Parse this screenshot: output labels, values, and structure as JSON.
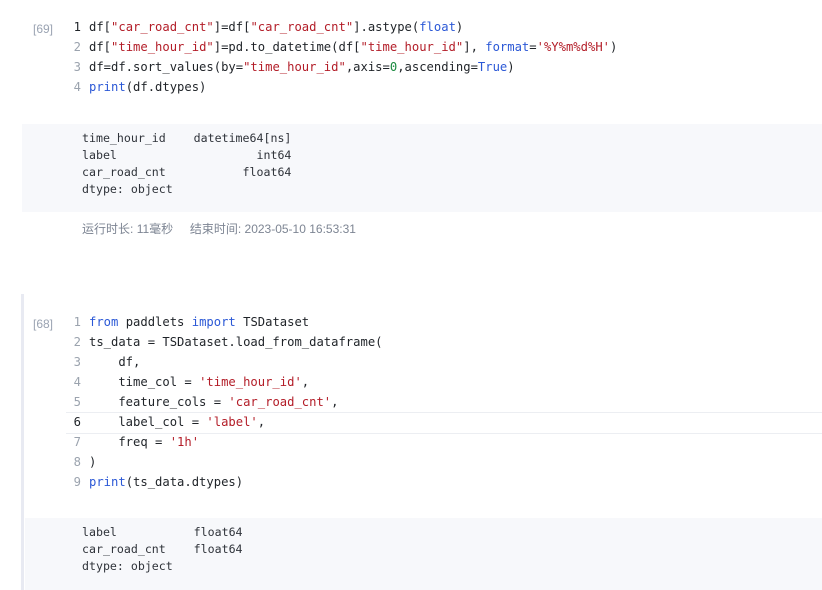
{
  "cells": [
    {
      "prompt": "[69]",
      "lines": [
        {
          "num": "1",
          "current": true,
          "tokens": [
            [
              "t",
              "df["
            ],
            [
              "s",
              "\"car_road_cnt\""
            ],
            [
              "t",
              "]=df["
            ],
            [
              "s",
              "\"car_road_cnt\""
            ],
            [
              "t",
              "].astype("
            ],
            [
              "k",
              "float"
            ],
            [
              "t",
              ")"
            ]
          ]
        },
        {
          "num": "2",
          "tokens": [
            [
              "t",
              "df["
            ],
            [
              "s",
              "\"time_hour_id\""
            ],
            [
              "t",
              "]=pd.to_datetime(df["
            ],
            [
              "s",
              "\"time_hour_id\""
            ],
            [
              "t",
              "], "
            ],
            [
              "k",
              "format"
            ],
            [
              "t",
              "="
            ],
            [
              "s",
              "'%Y%m%d%H'"
            ],
            [
              "t",
              ")"
            ]
          ]
        },
        {
          "num": "3",
          "tokens": [
            [
              "t",
              "df=df.sort_values(by="
            ],
            [
              "s",
              "\"time_hour_id\""
            ],
            [
              "t",
              ",axis="
            ],
            [
              "n",
              "0"
            ],
            [
              "t",
              ",ascending="
            ],
            [
              "k",
              "True"
            ],
            [
              "t",
              ")"
            ]
          ]
        },
        {
          "num": "4",
          "tokens": [
            [
              "k",
              "print"
            ],
            [
              "t",
              "(df.dtypes)"
            ]
          ]
        }
      ],
      "output": "time_hour_id    datetime64[ns]\nlabel                    int64\ncar_road_cnt           float64\ndtype: object",
      "exec_label": "运行时长:",
      "exec_duration": "11毫秒",
      "end_label": "结束时间:",
      "end_time": "2023-05-10 16:53:31"
    },
    {
      "prompt": "[68]",
      "lines": [
        {
          "num": "1",
          "tokens": [
            [
              "k",
              "from"
            ],
            [
              "t",
              " paddlets "
            ],
            [
              "k",
              "import"
            ],
            [
              "t",
              " TSDataset"
            ]
          ]
        },
        {
          "num": "2",
          "tokens": [
            [
              "t",
              "ts_data = TSDataset.load_from_dataframe("
            ]
          ]
        },
        {
          "num": "3",
          "tokens": [
            [
              "t",
              "    df,"
            ]
          ]
        },
        {
          "num": "4",
          "tokens": [
            [
              "t",
              "    time_col = "
            ],
            [
              "s",
              "'time_hour_id'"
            ],
            [
              "t",
              ","
            ]
          ]
        },
        {
          "num": "5",
          "tokens": [
            [
              "t",
              "    feature_cols = "
            ],
            [
              "s",
              "'car_road_cnt'"
            ],
            [
              "t",
              ","
            ]
          ]
        },
        {
          "num": "6",
          "current": true,
          "active": true,
          "tokens": [
            [
              "t",
              "    label_col = "
            ],
            [
              "s",
              "'label'"
            ],
            [
              "t",
              ","
            ]
          ]
        },
        {
          "num": "7",
          "tokens": [
            [
              "t",
              "    freq = "
            ],
            [
              "s",
              "'1h'"
            ]
          ]
        },
        {
          "num": "8",
          "tokens": [
            [
              "t",
              ")"
            ]
          ]
        },
        {
          "num": "9",
          "tokens": [
            [
              "k",
              "print"
            ],
            [
              "t",
              "(ts_data.dtypes)"
            ]
          ]
        }
      ],
      "output": "label           float64\ncar_road_cnt    float64\ndtype: object"
    }
  ]
}
